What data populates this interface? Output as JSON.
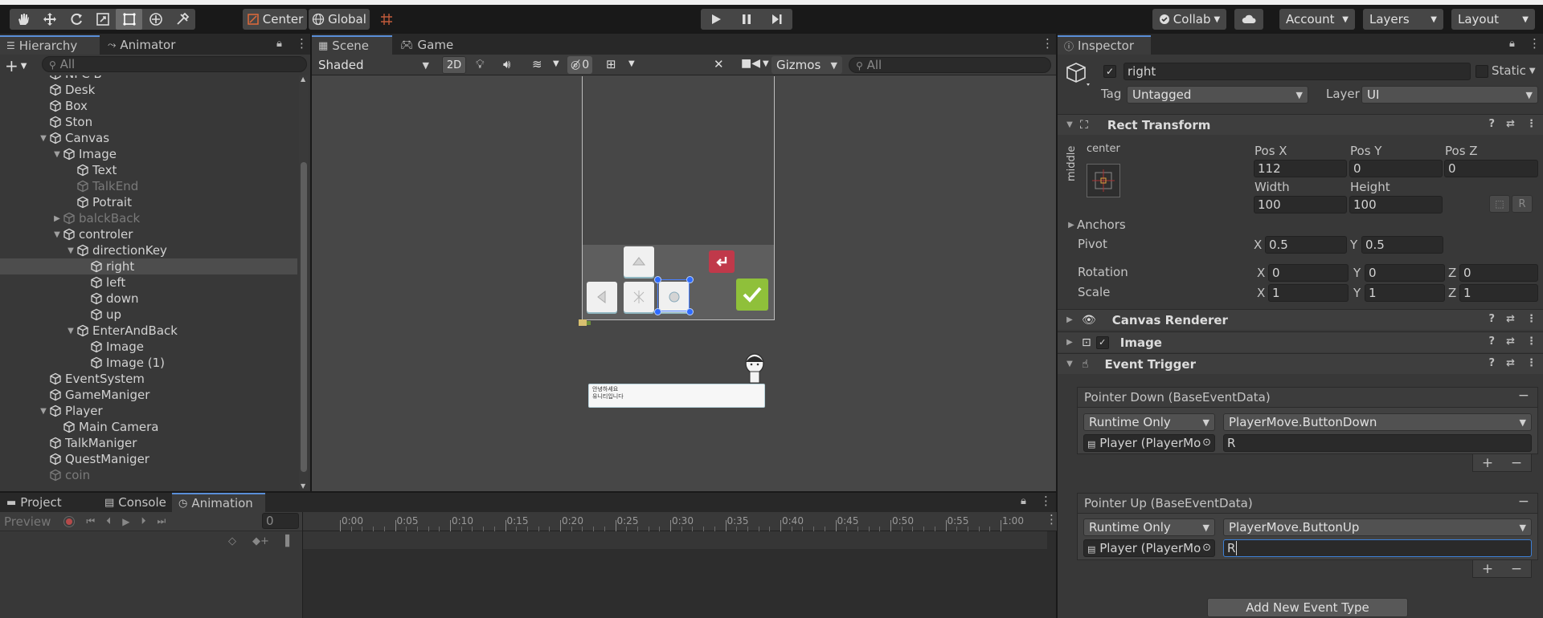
{
  "toolbar": {
    "tools": [
      "hand-icon",
      "move-icon",
      "rotate-icon",
      "scale-icon",
      "rect-icon",
      "transform-icon",
      "custom-tool-icon"
    ],
    "pivot_label": "Center",
    "space_label": "Global",
    "collab_label": "Collab",
    "account_label": "Account",
    "layers_label": "Layers",
    "layout_label": "Layout"
  },
  "hierarchy": {
    "tab_label": "Hierarchy",
    "animator_tab": "Animator",
    "search_placeholder": "All",
    "items": [
      {
        "label": "NPC B",
        "dim": false
      },
      {
        "label": "Desk",
        "dim": false
      },
      {
        "label": "Box",
        "dim": false
      },
      {
        "label": "Ston",
        "dim": false
      },
      {
        "label": "Canvas",
        "dim": false
      },
      {
        "label": "Image",
        "dim": false
      },
      {
        "label": "Text",
        "dim": false
      },
      {
        "label": "TalkEnd",
        "dim": true
      },
      {
        "label": "Potrait",
        "dim": false
      },
      {
        "label": "balckBack",
        "dim": true
      },
      {
        "label": "controler",
        "dim": false
      },
      {
        "label": "directionKey",
        "dim": false
      },
      {
        "label": "right",
        "dim": false
      },
      {
        "label": "left",
        "dim": false
      },
      {
        "label": "down",
        "dim": false
      },
      {
        "label": "up",
        "dim": false
      },
      {
        "label": "EnterAndBack",
        "dim": false
      },
      {
        "label": "Image",
        "dim": false
      },
      {
        "label": "Image (1)",
        "dim": false
      },
      {
        "label": "EventSystem",
        "dim": false
      },
      {
        "label": "GameManiger",
        "dim": false
      },
      {
        "label": "Player",
        "dim": false
      },
      {
        "label": "Main Camera",
        "dim": false
      },
      {
        "label": "TalkManiger",
        "dim": false
      },
      {
        "label": "QuestManiger",
        "dim": false
      },
      {
        "label": "coin",
        "dim": true
      }
    ]
  },
  "scene": {
    "scene_tab": "Scene",
    "game_tab": "Game",
    "shading": "Shaded",
    "mode_2d": "2D",
    "hidden_count": "0",
    "gizmos": "Gizmos",
    "search_placeholder": "All",
    "dialog_line1": "안녕하세요",
    "dialog_line2": "유니티입니다"
  },
  "bottom": {
    "project_tab": "Project",
    "console_tab": "Console",
    "animation_tab": "Animation",
    "preview_label": "Preview",
    "frame_value": "0",
    "ruler": [
      "0:00",
      "0:05",
      "0:10",
      "0:15",
      "0:20",
      "0:25",
      "0:30",
      "0:35",
      "0:40",
      "0:45",
      "0:50",
      "0:55",
      "1:00"
    ]
  },
  "inspector": {
    "tab_label": "Inspector",
    "object_name": "right",
    "static_label": "Static",
    "tag_label": "Tag",
    "tag_value": "Untagged",
    "layer_label": "Layer",
    "layer_value": "UI",
    "rect_transform": {
      "title": "Rect Transform",
      "anchor_h": "center",
      "anchor_v": "middle",
      "posx_label": "Pos X",
      "posx": "112",
      "posy_label": "Pos Y",
      "posy": "0",
      "posz_label": "Pos Z",
      "posz": "0",
      "width_label": "Width",
      "width": "100",
      "height_label": "Height",
      "height": "100",
      "r_button": "R",
      "anchors_label": "Anchors",
      "pivot_label": "Pivot",
      "pivot_x": "0.5",
      "pivot_y": "0.5",
      "rotation_label": "Rotation",
      "rot_x": "0",
      "rot_y": "0",
      "rot_z": "0",
      "scale_label": "Scale",
      "scale_x": "1",
      "scale_y": "1",
      "scale_z": "1",
      "x": "X",
      "y": "Y",
      "z": "Z"
    },
    "canvas_renderer": "Canvas Renderer",
    "image": "Image",
    "event_trigger": {
      "title": "Event Trigger",
      "pointer_down": "Pointer Down (BaseEventData)",
      "pointer_up": "Pointer Up (BaseEventData)",
      "runtime": "Runtime Only",
      "down_func": "PlayerMove.ButtonDown",
      "up_func": "PlayerMove.ButtonUp",
      "target": "Player (PlayerMo",
      "down_arg": "R",
      "up_arg": "R",
      "add_event": "Add New Event Type",
      "plus": "+",
      "minus": "−"
    }
  },
  "colors": {
    "selected_row": "#2c5d87",
    "accent": "#5a8fd8",
    "confirm_green": "#8fc03a",
    "back_red": "#c0394a"
  }
}
